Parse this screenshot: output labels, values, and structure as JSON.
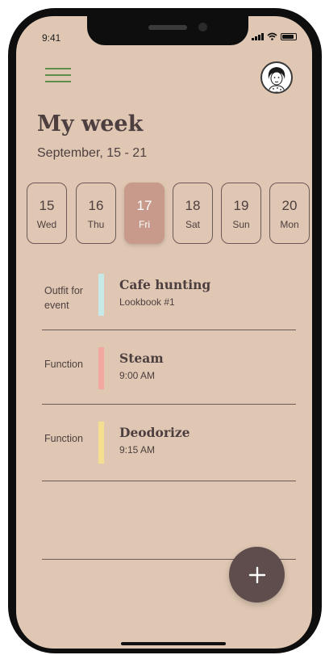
{
  "status_bar": {
    "time": "9:41"
  },
  "header": {
    "title": "My week",
    "subtitle": "September, 15 - 21"
  },
  "days": [
    {
      "num": "15",
      "name": "Wed",
      "active": false
    },
    {
      "num": "16",
      "name": "Thu",
      "active": false
    },
    {
      "num": "17",
      "name": "Fri",
      "active": true
    },
    {
      "num": "18",
      "name": "Sat",
      "active": false
    },
    {
      "num": "19",
      "name": "Sun",
      "active": false
    },
    {
      "num": "20",
      "name": "Mon",
      "active": false
    }
  ],
  "events": [
    {
      "category": "Outfit for event",
      "title": "Cafe hunting",
      "subtitle": "Lookbook #1",
      "color": "#c6e9e7"
    },
    {
      "category": "Function",
      "title": "Steam",
      "subtitle": "9:00 AM",
      "color": "#f2a7a0"
    },
    {
      "category": "Function",
      "title": "Deodorize",
      "subtitle": "9:15 AM",
      "color": "#f5df8f"
    }
  ],
  "fab": {
    "icon": "plus-icon"
  },
  "colors": {
    "background": "#dfc7b3",
    "accent": "#c79a8b",
    "fab": "#5f4d4d",
    "menu": "#5a8f4a"
  }
}
